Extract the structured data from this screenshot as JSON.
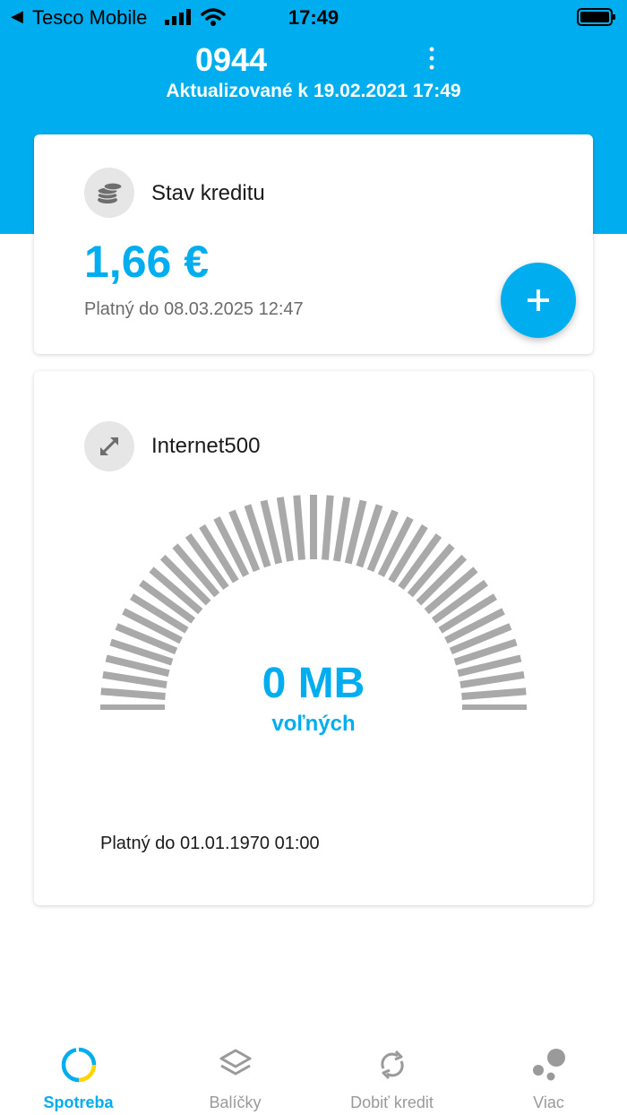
{
  "status_bar": {
    "carrier": "Tesco Mobile",
    "time": "17:49"
  },
  "header": {
    "phone_number": "0944",
    "updated": "Aktualizované k 19.02.2021 17:49"
  },
  "credit": {
    "title": "Stav kreditu",
    "amount": "1,66 €",
    "valid": "Platný do 08.03.2025 12:47"
  },
  "data_package": {
    "title": "Internet500",
    "remaining": "0 MB",
    "remaining_label": "voľných",
    "valid": "Platný do 01.01.1970 01:00",
    "remaining_fraction": 0
  },
  "tabs": [
    {
      "label": "Spotreba",
      "icon": "usage-icon",
      "active": true
    },
    {
      "label": "Balíčky",
      "icon": "layers-icon",
      "active": false
    },
    {
      "label": "Dobiť kredit",
      "icon": "refresh-icon",
      "active": false
    },
    {
      "label": "Viac",
      "icon": "more-dots-icon",
      "active": false
    }
  ],
  "colors": {
    "accent": "#00aeef",
    "gauge_inactive": "#a9a9a9",
    "tab_inactive": "#9a9a9a"
  }
}
